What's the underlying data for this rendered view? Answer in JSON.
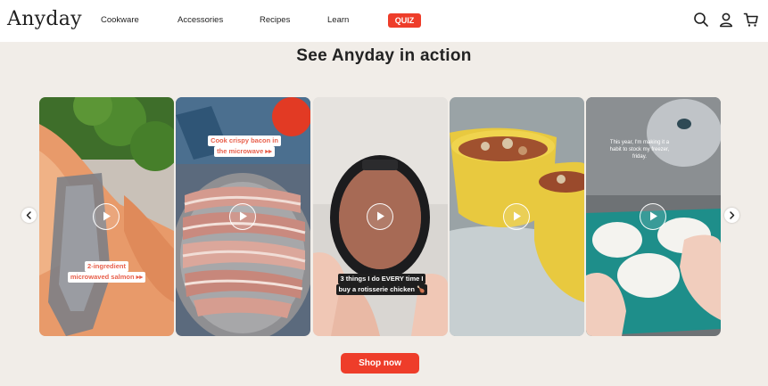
{
  "header": {
    "logo": "Anyday",
    "nav": [
      "Cookware",
      "Accessories",
      "Recipes",
      "Learn"
    ],
    "quiz_label": "QUIZ",
    "icons": [
      "search-icon",
      "account-icon",
      "cart-icon"
    ]
  },
  "section": {
    "title": "See Anyday in action"
  },
  "carousel": {
    "prev_icon": "chevron-left-icon",
    "next_icon": "chevron-right-icon",
    "cards": [
      {
        "caption_lines": [
          "2-ingredient",
          "microwaved salmon ▸▸"
        ]
      },
      {
        "caption_lines": [
          "Cook crispy bacon in",
          "the microwave ▸▸"
        ]
      },
      {
        "caption_lines": [
          "3 things I do EVERY time I",
          "buy a rotisserie chicken 🍗"
        ]
      },
      {
        "caption_lines": []
      },
      {
        "caption_lines": [
          "This year, I'm making it a",
          "habit to stock my freezer,",
          "friday."
        ]
      }
    ]
  },
  "cta": {
    "shop_label": "Shop now"
  },
  "colors": {
    "accent": "#ee3d2a",
    "background": "#f1ede8"
  }
}
